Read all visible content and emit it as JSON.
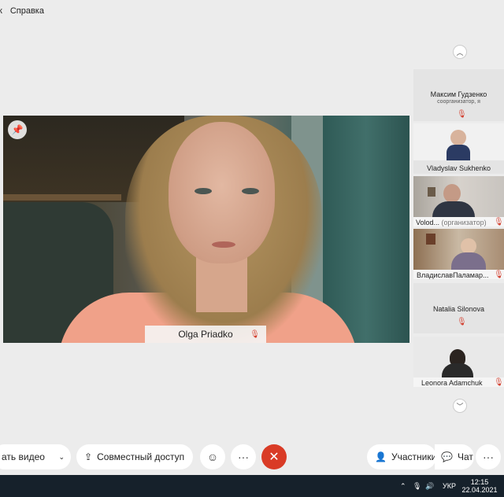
{
  "menu": {
    "left_fragment": "к",
    "help": "Справка"
  },
  "main_video": {
    "participant_name": "Olga Priadko"
  },
  "participants": [
    {
      "name": "Максим Гудзенко",
      "role": "соорганизатор, я"
    },
    {
      "name": "Vladyslav Sukhenko"
    },
    {
      "name": "Volod...",
      "role": "(организатор)"
    },
    {
      "name": "ВладиславПаламар..."
    },
    {
      "name": "Natalia Silonova"
    },
    {
      "name": "Leonora Adamchuk"
    }
  ],
  "toolbar": {
    "video_label": "ать видео",
    "share_label": "Совместный доступ",
    "participants_label": "Участники",
    "chat_label": "Чат"
  },
  "taskbar": {
    "lang": "УКР",
    "time": "12:15",
    "date": "22.04.2021"
  },
  "colors": {
    "hangup": "#d93b26",
    "muted_mic": "#d33c2b",
    "taskbar": "#16212b"
  }
}
